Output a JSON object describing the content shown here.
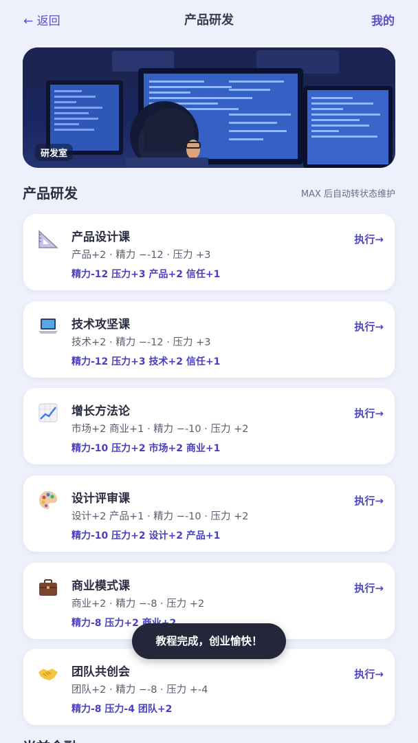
{
  "header": {
    "back_label": "← 返回",
    "title": "产品研发",
    "mine_label": "我的"
  },
  "banner": {
    "tag": "研发室"
  },
  "section": {
    "title": "产品研发",
    "note": "MAX 后自动转状态维护"
  },
  "courses": [
    {
      "icon": "triangle-ruler-icon",
      "name": "产品设计课",
      "desc": "产品+2 · 精力 −-12 · 压力 +3",
      "effect": "精力-12 压力+3 产品+2 信任+1",
      "action": "执行→"
    },
    {
      "icon": "laptop-icon",
      "name": "技术攻坚课",
      "desc": "技术+2 · 精力 −-12 · 压力 +3",
      "effect": "精力-12 压力+3 技术+2 信任+1",
      "action": "执行→"
    },
    {
      "icon": "chart-increasing-icon",
      "name": "增长方法论",
      "desc": "市场+2 商业+1 · 精力 −-10 · 压力 +2",
      "effect": "精力-10 压力+2 市场+2 商业+1",
      "action": "执行→"
    },
    {
      "icon": "palette-icon",
      "name": "设计评审课",
      "desc": "设计+2 产品+1 · 精力 −-10 · 压力 +2",
      "effect": "精力-10 压力+2 设计+2 产品+1",
      "action": "执行→"
    },
    {
      "icon": "briefcase-icon",
      "name": "商业模式课",
      "desc": "商业+2 · 精力 −-8 · 压力 +2",
      "effect": "精力-8 压力+2 商业+2",
      "action": "执行→"
    },
    {
      "icon": "handshake-icon",
      "name": "团队共创会",
      "desc": "团队+2 · 精力 −-8 · 压力 +-4",
      "effect": "精力-8 压力-4 团队+2",
      "action": "执行→"
    }
  ],
  "toast": "教程完成，创业愉快！",
  "next_section_title": "当前金融"
}
